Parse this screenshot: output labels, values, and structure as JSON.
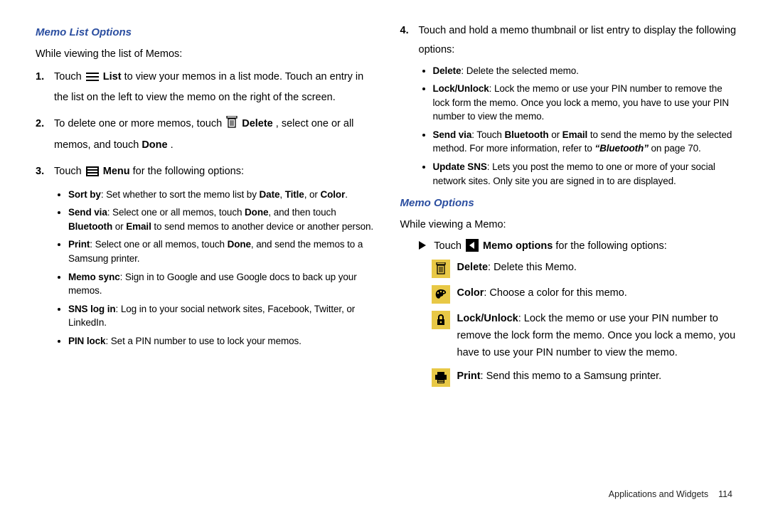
{
  "left": {
    "heading": "Memo List Options",
    "intro": "While viewing the list of Memos:",
    "steps": {
      "s1": {
        "n": "1.",
        "t1": "Touch ",
        "list": "List",
        "t2": " to view your memos in a list mode. Touch an entry in the list on the left to view the memo on the right of the screen."
      },
      "s2": {
        "n": "2.",
        "t1": "To delete one or more memos, touch ",
        "del": "Delete",
        "t2": ", select one or all memos, and touch ",
        "done": "Done",
        "t3": "."
      },
      "s3": {
        "n": "3.",
        "t1": "Touch ",
        "menu": "Menu",
        "t2": " for the following options:",
        "sub": {
          "a": {
            "h": "Sort by",
            "t1": ": Set whether to sort the memo list by ",
            "b1": "Date",
            "c1": ", ",
            "b2": "Title",
            "c2": ", or ",
            "b3": "Color",
            "t2": "."
          },
          "b": {
            "h": "Send via",
            "t1": ": Select one or all memos, touch ",
            "b1": "Done",
            "t2": ", and then touch ",
            "b2": "Bluetooth",
            "t3": " or ",
            "b3": "Email",
            "t4": " to send memos to another device or another person."
          },
          "c": {
            "h": "Print",
            "t1": ": Select one or all memos, touch ",
            "b1": "Done",
            "t2": ", and send the memos to a Samsung printer."
          },
          "d": {
            "h": "Memo sync",
            "t": ": Sign in to Google and use Google docs to back up your memos."
          },
          "e": {
            "h": "SNS log in",
            "t": ": Log in to your social network sites, Facebook, Twitter, or LinkedIn."
          },
          "f": {
            "h": "PIN lock",
            "t": ": Set a PIN number to use to lock your memos."
          }
        }
      }
    }
  },
  "right": {
    "step4": {
      "n": "4.",
      "t": "Touch and hold a memo thumbnail or list entry to display the following options:",
      "sub": {
        "a": {
          "h": "Delete",
          "t": ": Delete the selected memo."
        },
        "b": {
          "h": "Lock/Unlock",
          "t": ": Lock the memo or use your PIN number to remove the lock form the memo. Once you lock a memo, you have to use your PIN number to view the memo."
        },
        "c": {
          "h": "Send via",
          "t1": ": Touch ",
          "b1": "Bluetooth",
          "t2": " or ",
          "b2": "Email",
          "t3": " to send the memo by the selected method. For more information, refer to ",
          "ref": "“Bluetooth”",
          "t4": "  on page 70."
        },
        "d": {
          "h": "Update SNS",
          "t": ": Lets you post the memo to one or more of your social network sites. Only site you are signed in to are displayed."
        }
      }
    },
    "heading2": "Memo Options",
    "intro2": "While viewing a Memo:",
    "touchline": {
      "t1": "Touch ",
      "b": "Memo options",
      "t2": " for the following options:"
    },
    "opts": {
      "del": {
        "h": "Delete",
        "t": ": Delete this Memo."
      },
      "color": {
        "h": "Color",
        "t": ": Choose a color for this memo."
      },
      "lock": {
        "h": "Lock/Unlock",
        "t": ": Lock the memo or use your PIN number to remove the lock form the memo. Once you lock a memo, you have to use your PIN number to view the memo."
      },
      "print": {
        "h": "Print",
        "t": ": Send this memo to a Samsung printer."
      }
    }
  },
  "footer": {
    "section": "Applications and Widgets",
    "page": "114"
  }
}
